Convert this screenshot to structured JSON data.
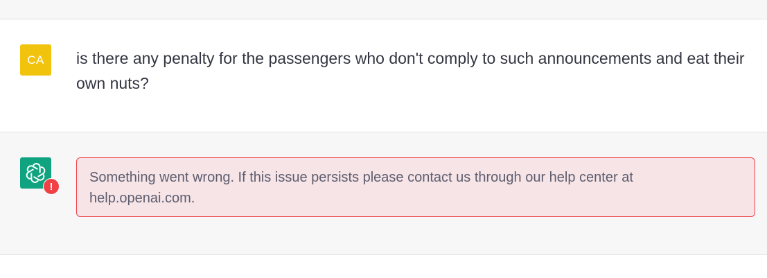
{
  "user": {
    "initials": "CA",
    "avatar_color": "#f2c30c",
    "message": "is there any penalty for the passengers who don't comply to such announcements and eat their own nuts?"
  },
  "assistant": {
    "avatar_icon": "openai-logo-icon",
    "avatar_color": "#10a37f",
    "error_badge": "!",
    "error_message": "Something went wrong. If this issue persists please contact us through our help center at help.openai.com."
  },
  "colors": {
    "error_border": "#ef4146",
    "error_background": "#f6e4e7",
    "text": "#343541"
  }
}
